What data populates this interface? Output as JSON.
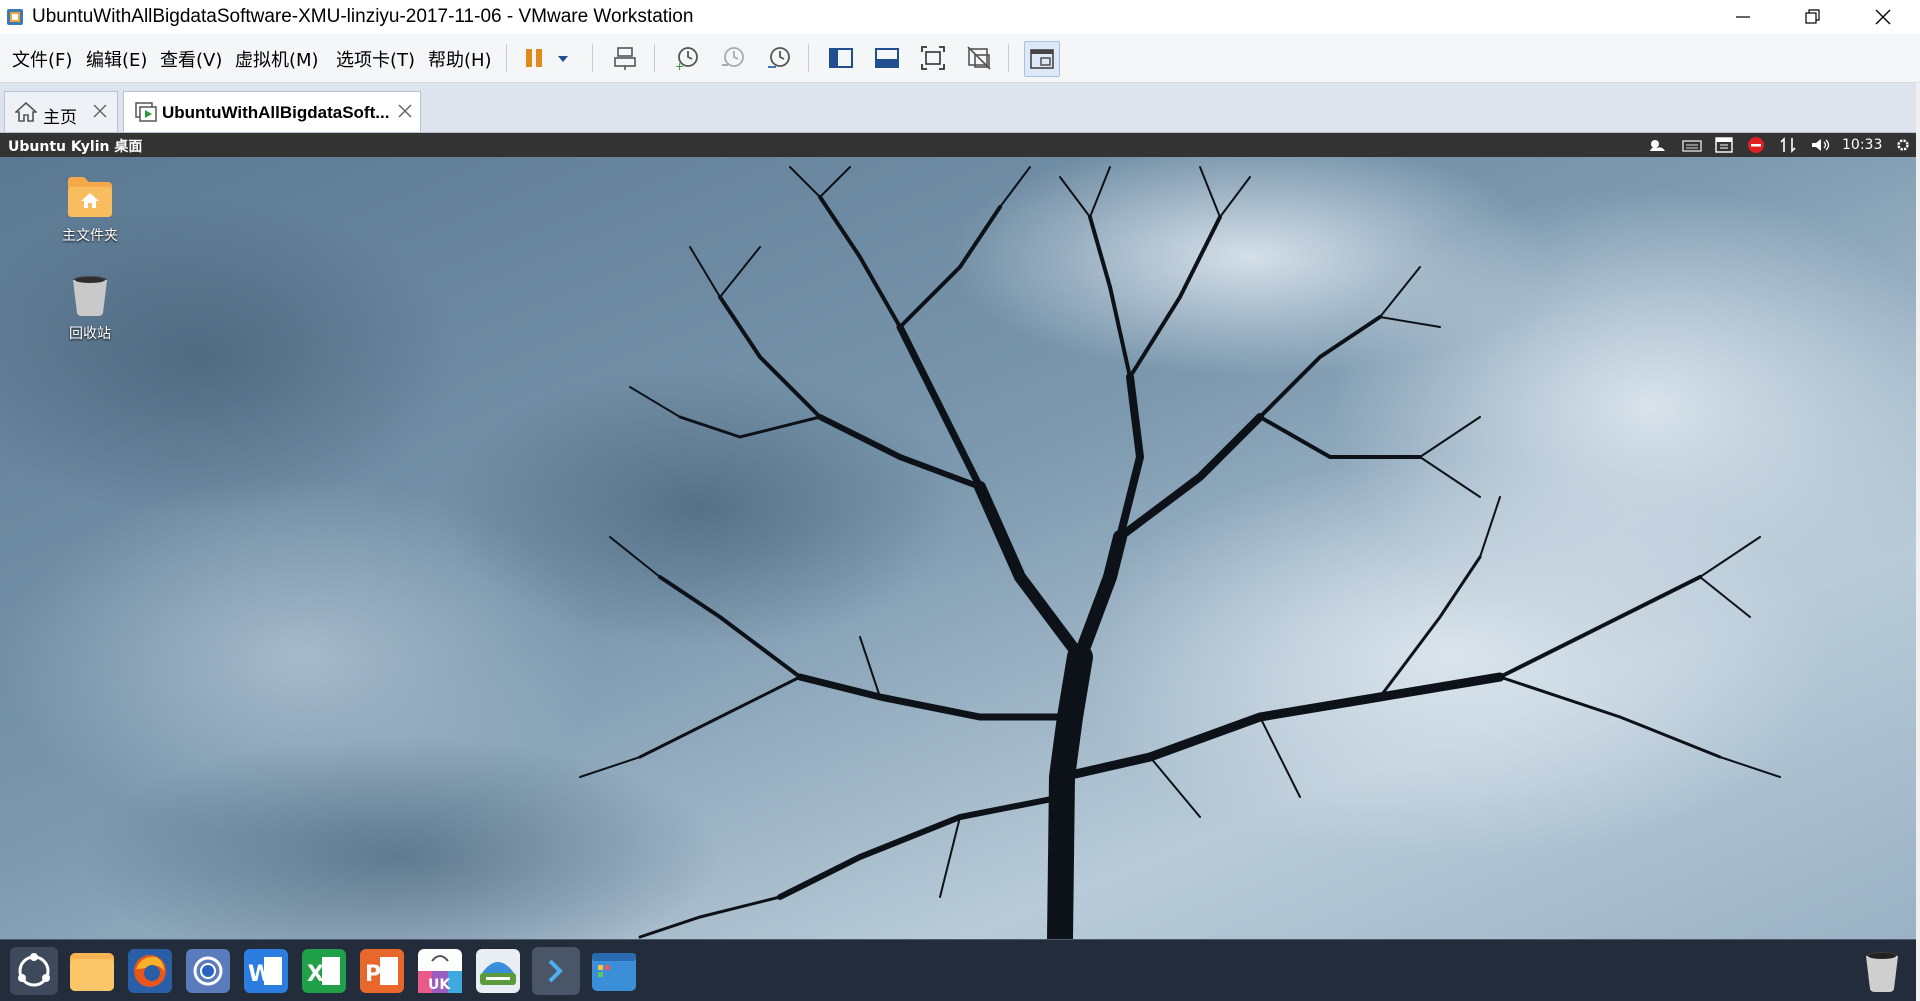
{
  "window": {
    "title": "UbuntuWithAllBigdataSoftware-XMU-linziyu-2017-11-06 - VMware Workstation",
    "app_icon": "vmware-icon"
  },
  "menu": {
    "items": [
      {
        "label": "文件(F)"
      },
      {
        "label": "编辑(E)"
      },
      {
        "label": "查看(V)"
      },
      {
        "label": "虚拟机(M)"
      },
      {
        "label": "选项卡(T)"
      },
      {
        "label": "帮助(H)"
      }
    ]
  },
  "toolbar": {
    "icons": [
      "pause-icon",
      "dropdown-arrow-icon",
      "send-ctrl-alt-del-icon",
      "snapshot-icon",
      "revert-snapshot-icon",
      "snapshot-manager-icon",
      "show-library-icon",
      "thumbnail-bar-icon",
      "full-screen-icon",
      "unity-icon",
      "console-view-icon"
    ],
    "accent_color": "#e08a1e"
  },
  "tabs": [
    {
      "label": "主页",
      "icon": "home-icon"
    },
    {
      "label": "UbuntuWithAllBigdataSoft...",
      "icon": "vm-icon",
      "active": true
    }
  ],
  "guest": {
    "panel_title": "Ubuntu Kylin 桌面",
    "clock": "10:33",
    "tray_icons": [
      "weather-icon",
      "keyboard-icon",
      "calendar-icon",
      "network-disabled-icon",
      "transfer-icon",
      "volume-icon",
      "settings-gear-icon"
    ],
    "desktop_icons": [
      {
        "label": "主文件夹",
        "icon": "home-folder-icon"
      },
      {
        "label": "回收站",
        "icon": "trash-icon"
      }
    ],
    "dock_items": [
      "ubuntu-kylin-start-icon",
      "files-icon",
      "firefox-icon",
      "chromium-icon",
      "wps-writer-icon",
      "wps-spreadsheet-icon",
      "wps-presentation-icon",
      "software-center-icon",
      "scanner-icon",
      "terminal-icon",
      "workspace-switcher-icon"
    ],
    "dock_trash_icon": "trash-icon"
  }
}
